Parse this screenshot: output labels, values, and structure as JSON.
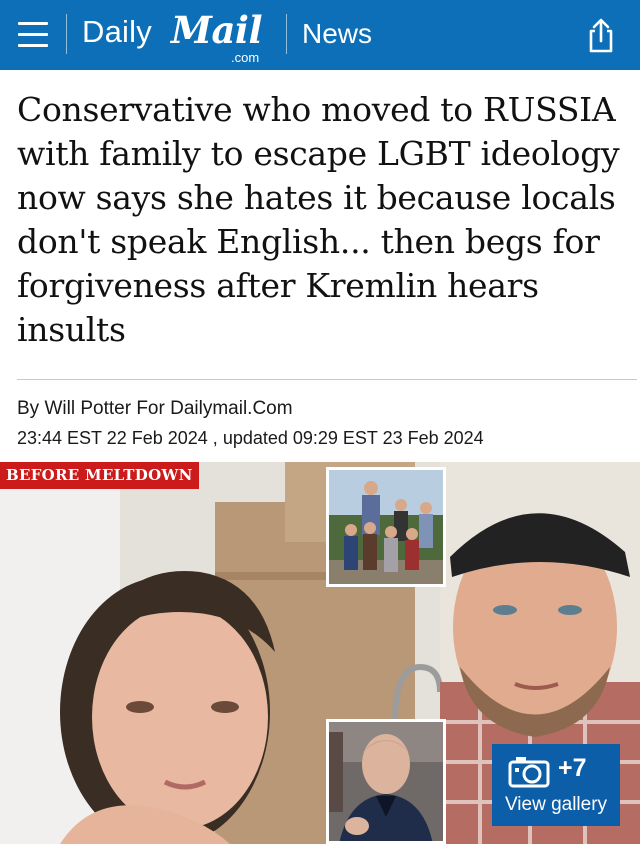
{
  "header": {
    "brand_daily": "Daily",
    "brand_mail": "Mail",
    "brand_domain": ".com",
    "section": "News",
    "menu_icon": "hamburger-menu-icon",
    "share_icon": "share-icon",
    "bg_color": "#0d6fb8"
  },
  "article": {
    "headline": "Conservative who moved to RUSSIA with family to escape LGBT ideology now says she hates it because locals don't speak English... then begs for forgiveness after Kremlin hears insults",
    "byline_prefix": "By",
    "author": "Will Potter For Dailymail.Com",
    "dateline": "23:44 EST 22 Feb 2024 , updated 09:29 EST 23 Feb 2024"
  },
  "hero": {
    "tag": "BEFORE MELTDOWN",
    "tag_color": "#cc1b1b",
    "gallery_count": "+7",
    "gallery_label": "View gallery",
    "gallery_icon": "camera-icon",
    "gallery_color": "#0d5ea9"
  }
}
